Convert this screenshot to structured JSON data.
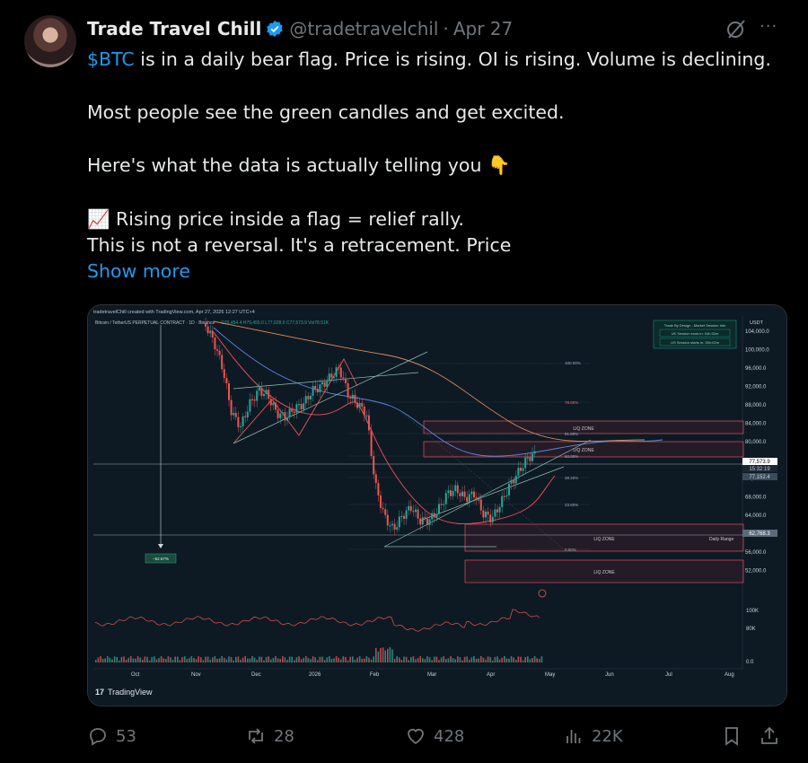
{
  "tweet": {
    "author_name": "Trade Travel Chill",
    "handle": "@tradetravelchil",
    "dot": "·",
    "date": "Apr 27",
    "cashtag": "$BTC",
    "line1_rest": " is in a daily bear flag. Price is rising. OI is rising. Volume is declining.",
    "line2": "Most people see the green candles and get excited.",
    "line3": "Here's what the data is actually telling you 👇",
    "line4": "📈 Rising price inside a flag = relief rally.",
    "line5": "This is not a reversal. It's a retracement. Price",
    "show_more": "Show more",
    "more_menu": "···"
  },
  "chart": {
    "credit": "tradetravelChill created with TradingView.com, Apr 27, 2026 12:27 UTC+4",
    "symbol": "Bitcoin / TetherUS PERPETUAL CONTRACT · 1D · Binance",
    "ohlc": "O79,454.4  H79,455.0  L77,028.0  C77,573.9  Vol78.51K",
    "currency": "USDT",
    "session_title": "Trade By Design - Market Session Info",
    "session_uk": "UK Session ends in: 04h:32m",
    "session_us": "US Session starts in: 05h:02m",
    "price_labels": [
      "104,000.0",
      "100,000.0",
      "96,000.0",
      "92,000.0",
      "88,000.0",
      "84,000.0",
      "80,000.0",
      "76,000.0",
      "72,000.0",
      "68,000.0",
      "64,000.0",
      "60,000.0",
      "56,000.0",
      "52,000.0"
    ],
    "current_price": "77,573.9",
    "countdown": "15:32:19",
    "ma_price": "77,152.4",
    "range_price": "62,768.3",
    "vol_labels": [
      "100K",
      "80K",
      "0.0"
    ],
    "fib_labels": [
      "100.00%",
      "78.60%",
      "61.80%",
      "50.00%",
      "38.20%",
      "23.60%",
      "0.00%"
    ],
    "liq_zone": "LIQ ZONE",
    "daily_range": "Daily Range",
    "drop_pct": "−52.67%",
    "months": [
      "Oct",
      "Nov",
      "Dec",
      "2026",
      "Feb",
      "Mar",
      "Apr",
      "May",
      "Jun",
      "Jul",
      "Aug"
    ],
    "brand": "TradingView",
    "colors": {
      "up": "#26a69a",
      "down": "#ef5350",
      "bg": "#0d1a24",
      "zone": "#ff5a6a"
    }
  },
  "actions": {
    "replies": "53",
    "reposts": "28",
    "likes": "428",
    "views": "22K"
  }
}
